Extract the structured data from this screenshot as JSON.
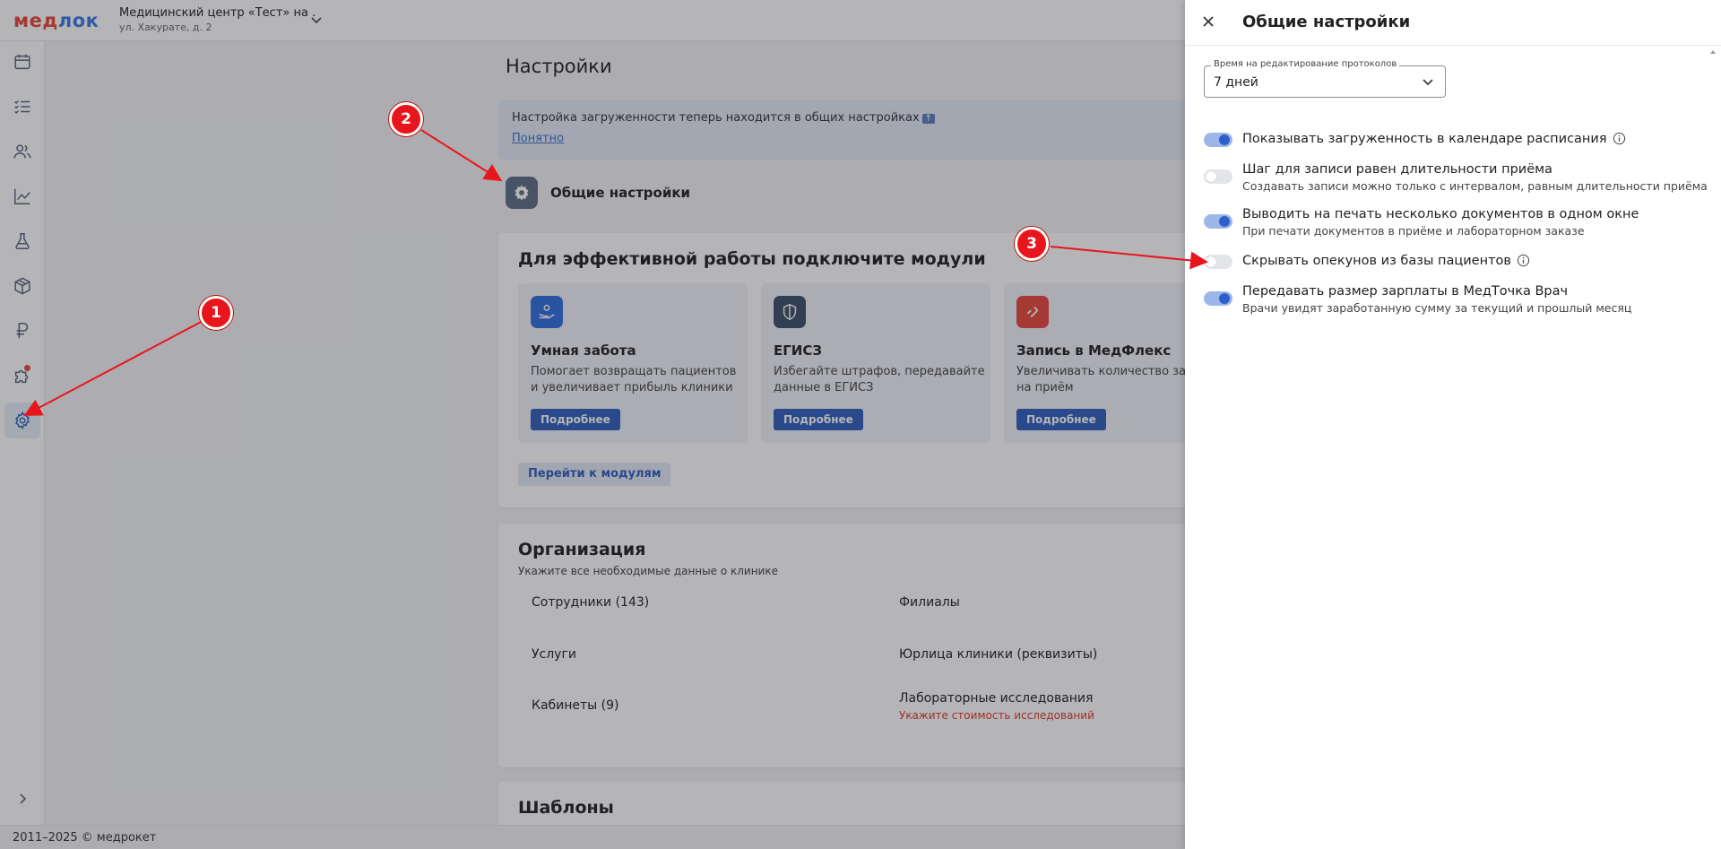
{
  "app": {
    "logo_prefix": "мед",
    "logo_suffix": "лок",
    "clinic_name": "Медицинский центр «Тест» на ...",
    "clinic_address": "ул. Хакурате, д. 2",
    "footer": "2011–2025 © медрокет"
  },
  "sidebar": {
    "items": [
      {
        "name": "calendar-icon"
      },
      {
        "name": "tasks-icon"
      },
      {
        "name": "patients-icon"
      },
      {
        "name": "analytics-icon"
      },
      {
        "name": "lab-flask-icon"
      },
      {
        "name": "warehouse-box-icon"
      },
      {
        "name": "ruble-icon"
      },
      {
        "name": "modules-puzzle-icon"
      },
      {
        "name": "settings-gear-icon",
        "active": true
      }
    ]
  },
  "main": {
    "title": "Настройки",
    "banner": {
      "text": "Настройка загруженности теперь находится в общих настройках",
      "tag": "↑",
      "link": "Понятно"
    },
    "general_settings_label": "Общие настройки",
    "modules": {
      "title": "Для эффективной работы подключите модули",
      "cards": [
        {
          "title": "Умная забота",
          "desc": "Помогает возвращать пациентов и увеличивает прибыль клиники",
          "button": "Подробнее",
          "color": "#2f6fe0"
        },
        {
          "title": "ЕГИСЗ",
          "desc": "Избегайте штрафов, передавайте данные в ЕГИСЗ",
          "button": "Подробнее",
          "color": "#3d4f6a"
        },
        {
          "title": "Запись в МедФлекс",
          "desc": "Увеличивать количество записей на приём",
          "button": "Подробнее",
          "color": "#e8473c"
        }
      ],
      "all_link": "Перейти к модулям"
    },
    "organization": {
      "title": "Организация",
      "subtitle": "Укажите все необходимые данные о клинике",
      "items": {
        "staff": "Сотрудники (143)",
        "branches": "Филиалы",
        "services": "Услуги",
        "legal": "Юрлица клиники (реквизиты)",
        "rooms": "Кабинеты (9)",
        "labs": "Лабораторные исследования",
        "labs_warning": "Укажите стоимость исследований"
      }
    },
    "templates": {
      "title": "Шаблоны"
    }
  },
  "drawer": {
    "title": "Общие настройки",
    "select": {
      "label": "Время на редактирование протоколов",
      "value": "7 дней"
    },
    "options": [
      {
        "label": "Показывать загруженность в календаре расписания",
        "sub": "",
        "on": true,
        "info": true
      },
      {
        "label": "Шаг для записи равен длительности приёма",
        "sub": "Создавать записи можно только с интервалом, равным длительности приёма",
        "on": false,
        "info": false
      },
      {
        "label": "Выводить на печать несколько документов в одном окне",
        "sub": "При печати документов в приёме и лабораторном заказе",
        "on": true,
        "info": false
      },
      {
        "label": "Скрывать опекунов из базы пациентов",
        "sub": "",
        "on": false,
        "info": true
      },
      {
        "label": "Передавать размер зарплаты в МедТочка Врач",
        "sub": "Врачи увидят заработанную сумму за текущий и прошлый месяц",
        "on": true,
        "info": false
      }
    ]
  },
  "annotations": [
    {
      "label": "1"
    },
    {
      "label": "2"
    },
    {
      "label": "3"
    }
  ],
  "colors": {
    "brand_red": "#e8473c",
    "brand_blue": "#3b78e7",
    "primary_button": "#2f5fbe",
    "toggle_on": "#2d5fc9",
    "warning_text": "#e0362b",
    "annotation_red": "#e8161c"
  }
}
